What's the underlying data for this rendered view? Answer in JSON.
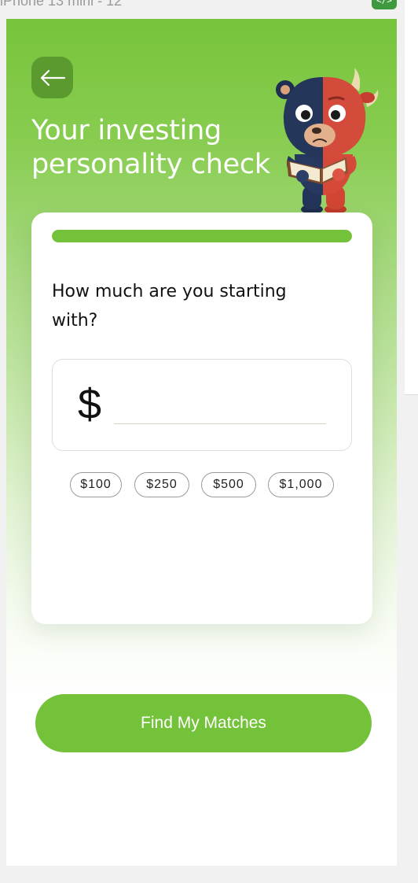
{
  "frame": {
    "label": "iPhone 13 mini - 12",
    "badge": "</>"
  },
  "header": {
    "title_line1": "Your investing",
    "title_line2": "personality check",
    "back_icon": "arrow-left-icon"
  },
  "mascot": {
    "icon": "bull-bear-mascot-reading-book"
  },
  "progress": {
    "fraction": 1.0
  },
  "question": {
    "text": "How much are you starting with?"
  },
  "amount": {
    "currency_symbol": "$",
    "value": "",
    "placeholder": ""
  },
  "chips": [
    "$100",
    "$250",
    "$500",
    "$1,000"
  ],
  "cta": {
    "label": "Find My Matches"
  },
  "colors": {
    "brand_green": "#74c23a",
    "back_button": "#5a9a2e",
    "card": "#ffffff",
    "text": "#111111"
  }
}
